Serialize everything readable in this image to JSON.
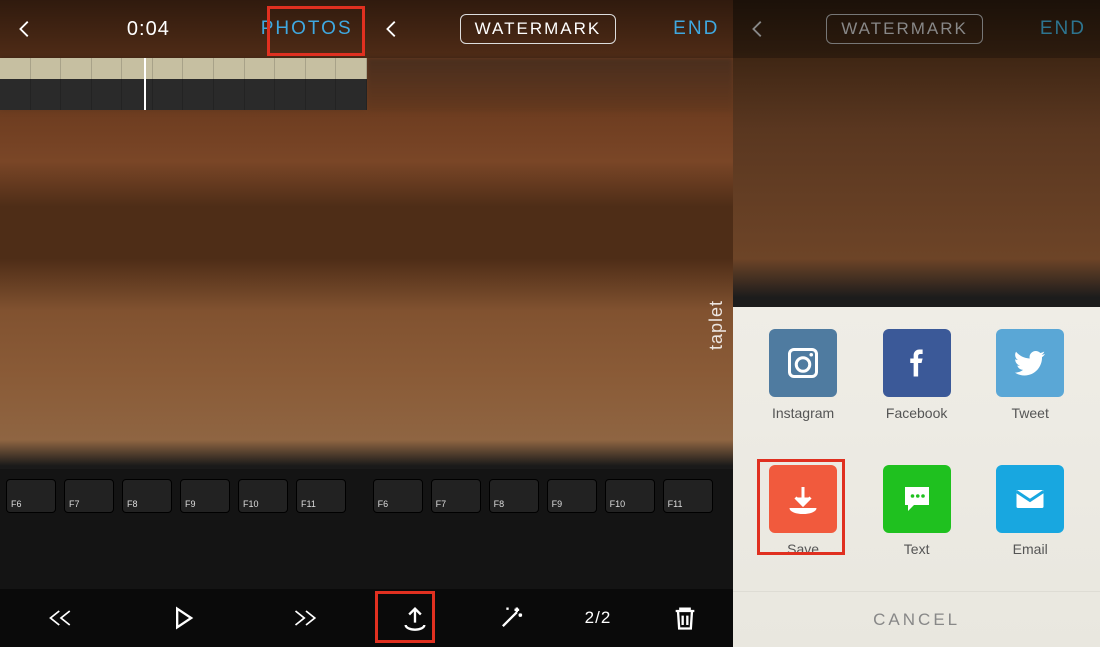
{
  "panel1": {
    "timecode": "0:04",
    "photos_label": "PHOTOS",
    "keyboard_keys": [
      "F6",
      "F7",
      "F8",
      "F9",
      "F10",
      "F11"
    ]
  },
  "panel2": {
    "watermark_label": "WATERMARK",
    "end_label": "END",
    "page_counter": "2/2",
    "vertical_mark": "taplet",
    "keyboard_keys": [
      "F6",
      "F7",
      "F8",
      "F9",
      "F10",
      "F11"
    ]
  },
  "panel3": {
    "watermark_label": "WATERMARK",
    "end_label": "END",
    "share": [
      {
        "name": "instagram",
        "label": "Instagram",
        "color": "#4f7ba0"
      },
      {
        "name": "facebook",
        "label": "Facebook",
        "color": "#3b5998"
      },
      {
        "name": "tweet",
        "label": "Tweet",
        "color": "#5aa7d6"
      },
      {
        "name": "save",
        "label": "Save",
        "color": "#f15a3d"
      },
      {
        "name": "text",
        "label": "Text",
        "color": "#1fc11f"
      },
      {
        "name": "email",
        "label": "Email",
        "color": "#18a7e0"
      }
    ],
    "cancel_label": "CANCEL"
  }
}
